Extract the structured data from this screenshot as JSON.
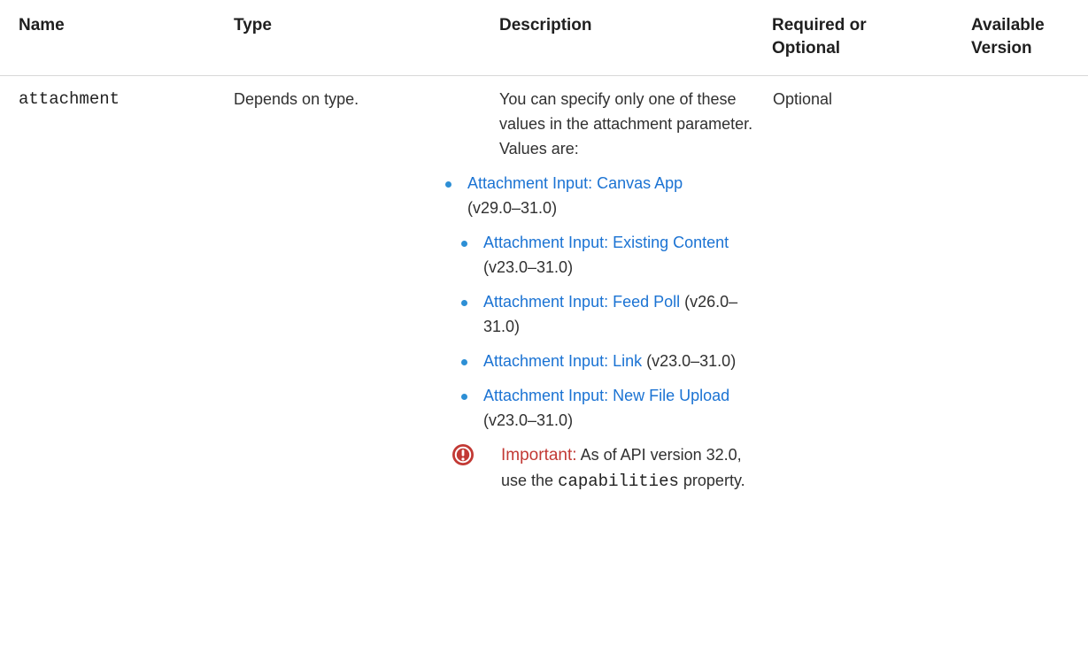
{
  "table": {
    "headers": {
      "name": "Name",
      "type": "Type",
      "description": "Description",
      "required_line1": "Required or",
      "required_line2": "Optional",
      "version_line1": "Available",
      "version_line2": "Version"
    },
    "row": {
      "name": "attachment",
      "type": "Depends on type.",
      "description_intro": "You can specify only one of these values in the attachment parameter. Values are:",
      "required": "Optional",
      "version": "",
      "values": [
        {
          "link": "Attachment Input: Canvas App",
          "version": "(v29.0–31.0)"
        },
        {
          "link": "Attachment Input: Existing Content",
          "version": "(v23.0–31.0)"
        },
        {
          "link": "Attachment Input: Feed Poll",
          "version": "(v26.0–31.0)"
        },
        {
          "link": "Attachment Input: Link",
          "version": "(v23.0–31.0)"
        },
        {
          "link": "Attachment Input: New File Upload",
          "version": "(v23.0–31.0)"
        }
      ],
      "note": {
        "icon": "important-icon",
        "title": "Important:",
        "text_before": "As of API version 32.0, use the",
        "code": "capabilities",
        "text_after": "property.",
        "color": "#c23934"
      }
    }
  },
  "colors": {
    "link": "#1b73d3",
    "bullet": "#2d8fd5",
    "important": "#c23934"
  }
}
